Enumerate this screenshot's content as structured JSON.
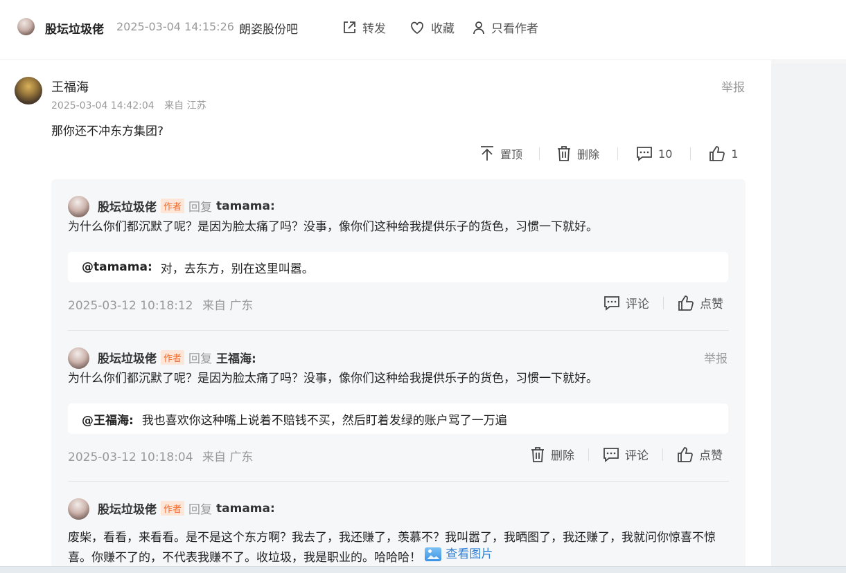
{
  "header": {
    "author_name": "股坛垃圾佬",
    "timestamp": "2025-03-04 14:15:26",
    "forum_name": "朗姿股份吧",
    "forward_label": "转发",
    "favorite_label": "收藏",
    "author_only_label": "只看作者"
  },
  "comment": {
    "author": "王福海",
    "report_label": "举报",
    "timestamp": "2025-03-04 14:42:04",
    "location": "来自 江苏",
    "content": "那你还不冲东方集团?",
    "actions": {
      "pin_label": "置顶",
      "delete_label": "删除",
      "reply_count": "10",
      "like_count": "1"
    }
  },
  "replies": [
    {
      "author": "股坛垃圾佬",
      "badge": "作者",
      "reply_word": "回复",
      "target": "tamama:",
      "text": "为什么你们都沉默了呢？是因为脸太痛了吗？没事，像你们这种给我提供乐子的货色，习惯一下就好。",
      "quote_at": "@tamama:",
      "quote_text": "对，去东方，别在这里叫嚣。",
      "timestamp": "2025-03-12 10:18:12",
      "location": "来自 广东",
      "comment_label": "评论",
      "like_label": "点赞"
    },
    {
      "author": "股坛垃圾佬",
      "badge": "作者",
      "reply_word": "回复",
      "target": "王福海:",
      "report_label": "举报",
      "text": "为什么你们都沉默了呢？是因为脸太痛了吗？没事，像你们这种给我提供乐子的货色，习惯一下就好。",
      "quote_at": "@王福海:",
      "quote_text": "我也喜欢你这种嘴上说着不赔钱不买，然后盯着发绿的账户骂了一万遍",
      "timestamp": "2025-03-12 10:18:04",
      "location": "来自 广东",
      "delete_label": "删除",
      "comment_label": "评论",
      "like_label": "点赞"
    },
    {
      "author": "股坛垃圾佬",
      "badge": "作者",
      "reply_word": "回复",
      "target": "tamama:",
      "text": "废柴，看看，来看看。是不是这个东方啊？我去了，我还赚了，羡慕不？我叫嚣了，我晒图了，我还赚了，我就问你惊喜不惊喜。你赚不了的，不代表我赚不了。收垃圾，我是职业的。哈哈哈！",
      "view_image_label": "查看图片"
    }
  ]
}
